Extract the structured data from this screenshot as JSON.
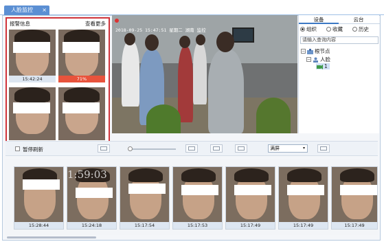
{
  "tabbar": {
    "tab_label": "人脸监控",
    "close_glyph": "×"
  },
  "alarm": {
    "title": "报警信息",
    "more_link": "查看更多",
    "cards": [
      {
        "time": "15:42:24",
        "highlight": false
      },
      {
        "time": "71%",
        "highlight": true
      },
      {
        "time": "",
        "highlight": false
      },
      {
        "time": "",
        "highlight": false
      }
    ]
  },
  "video": {
    "osd_text": "2018-09-25 15:47:51 星期二 湖南 监控"
  },
  "side": {
    "tabs": [
      "设备",
      "云台"
    ],
    "active_tab": 0,
    "radios": [
      {
        "label": "组织",
        "checked": true
      },
      {
        "label": "收藏",
        "checked": false
      },
      {
        "label": "历史",
        "checked": false
      }
    ],
    "search_placeholder": "请输入查询内容",
    "tree": {
      "root_label": "根节点",
      "child_label": "人脸",
      "leaf_label": "1"
    }
  },
  "toolbar": {
    "pause_label": "暂停刷新",
    "display_mode": "满屏",
    "select_arrow": "▾"
  },
  "strip": {
    "cards": [
      {
        "time": "15:28:44",
        "osd": ""
      },
      {
        "time": "15:24:18",
        "osd": "1:59:03"
      },
      {
        "time": "15:17:54",
        "osd": ""
      },
      {
        "time": "15:17:53",
        "osd": ""
      },
      {
        "time": "15:17:49",
        "osd": ""
      },
      {
        "time": "15:17:49",
        "osd": ""
      },
      {
        "time": "15:17:49",
        "osd": ""
      }
    ]
  }
}
